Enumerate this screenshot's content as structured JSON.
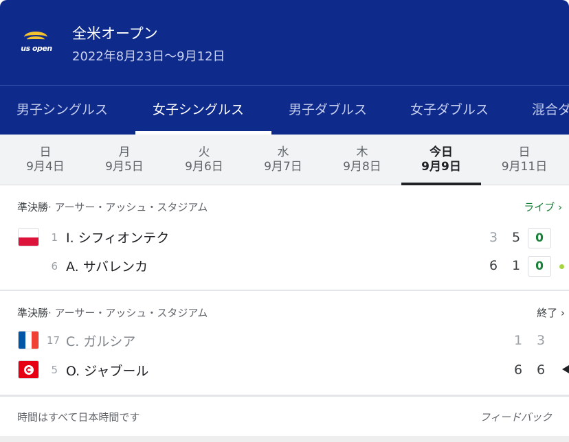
{
  "header": {
    "logo_text": "us open",
    "title": "全米オープン",
    "dates": "2022年8月23日〜9月12日",
    "bg_color": "#0e2a8a"
  },
  "tabs": [
    {
      "label": "男子シングルス"
    },
    {
      "label": "女子シングルス",
      "active": true
    },
    {
      "label": "男子ダブルス"
    },
    {
      "label": "女子ダブルス"
    },
    {
      "label": "混合ダ"
    }
  ],
  "days": [
    {
      "weekday": "日",
      "date": "9月4日"
    },
    {
      "weekday": "月",
      "date": "9月5日"
    },
    {
      "weekday": "火",
      "date": "9月6日"
    },
    {
      "weekday": "水",
      "date": "9月7日"
    },
    {
      "weekday": "木",
      "date": "9月8日"
    },
    {
      "weekday": "今日",
      "date": "9月9日",
      "active": true
    },
    {
      "weekday": "日",
      "date": "9月11日"
    }
  ],
  "matches": [
    {
      "round": "準決勝",
      "venue": "· アーサー・アッシュ・スタジアム",
      "status": "ライブ ›",
      "players": [
        {
          "seed": "1",
          "name": "I. シフィオンテク",
          "flag": "poland",
          "scores": [
            "3",
            "5"
          ],
          "current": "0"
        },
        {
          "seed": "6",
          "name": "A. サバレンカ",
          "flag": "",
          "scores": [
            "6",
            "1"
          ],
          "current": "0"
        }
      ]
    },
    {
      "round": "準決勝",
      "venue": "· アーサー・アッシュ・スタジアム",
      "status": "終了 ›",
      "players": [
        {
          "seed": "17",
          "name": "C. ガルシア",
          "flag": "france",
          "scores": [
            "1",
            "3"
          ]
        },
        {
          "seed": "5",
          "name": "O. ジャブール",
          "flag": "tunisia",
          "scores": [
            "6",
            "6"
          ]
        }
      ]
    }
  ],
  "footer": {
    "note": "時間はすべて日本時間です",
    "feedback": "フィードバック"
  },
  "colors": {
    "live": "#188038",
    "serve_dot": "#a5d63f"
  }
}
